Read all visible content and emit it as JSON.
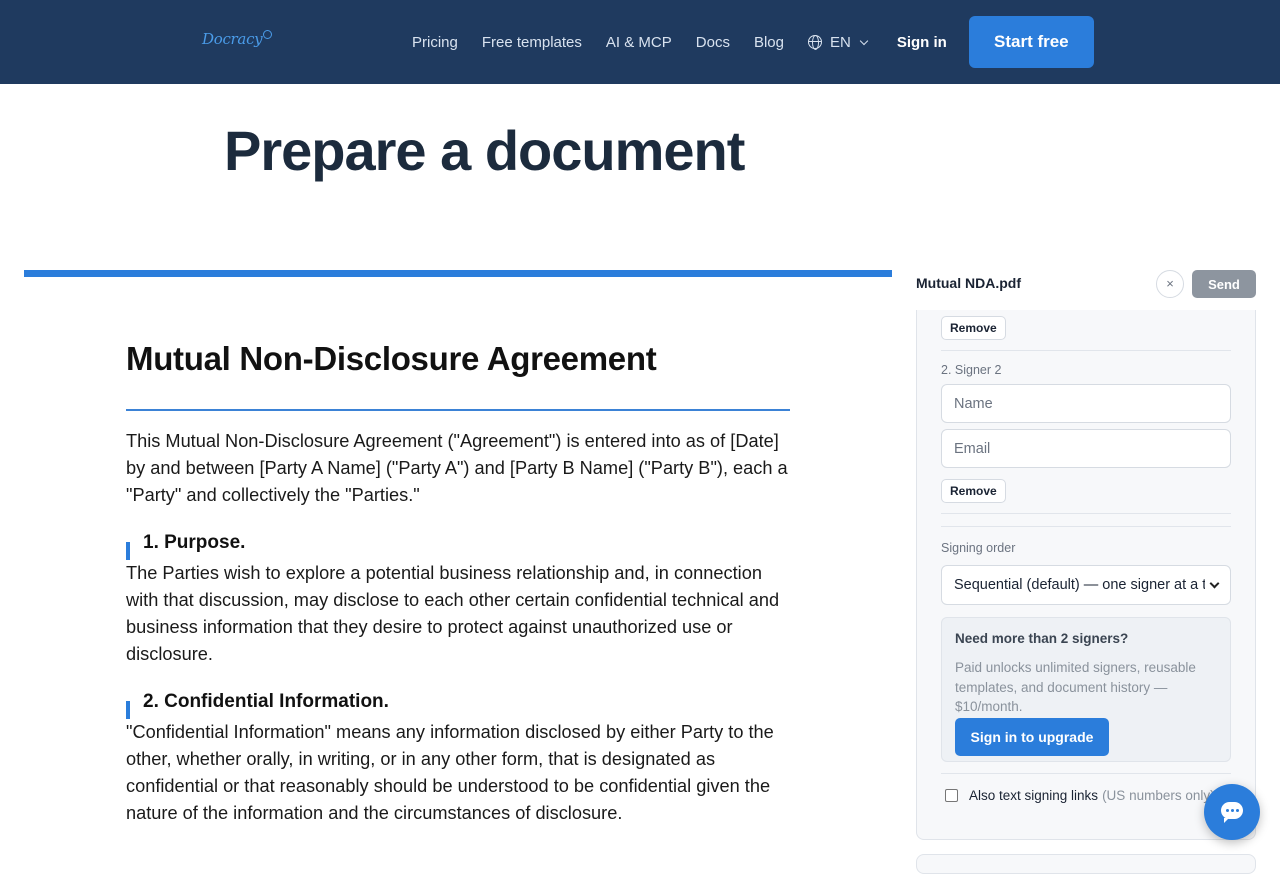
{
  "header": {
    "logo": "Docracy",
    "nav": [
      "Pricing",
      "Free templates",
      "AI & MCP",
      "Docs",
      "Blog"
    ],
    "language": "EN",
    "sign_in": "Sign in",
    "start_free": "Start free"
  },
  "page": {
    "title": "Prepare a document"
  },
  "document": {
    "title": "Mutual Non-Disclosure Agreement",
    "intro": "This Mutual Non-Disclosure Agreement (\"Agreement\") is entered into as of [Date] by and between [Party A Name] (\"Party A\") and [Party B Name] (\"Party B\"), each a \"Party\" and collectively the \"Parties.\"",
    "sections": [
      {
        "heading": "1. Purpose.",
        "body": "The Parties wish to explore a potential business relationship and, in connection with that discussion, may disclose to each other certain confidential technical and business information that they desire to protect against unauthorized use or disclosure."
      },
      {
        "heading": "2. Confidential Information.",
        "body": "\"Confidential Information\" means any information disclosed by either Party to the other, whether orally, in writing, or in any other form, that is designated as confidential or that reasonably should be understood to be confidential given the nature of the information and the circumstances of disclosure."
      }
    ]
  },
  "panel": {
    "file_name": "Mutual NDA.pdf",
    "close": "×",
    "send": "Send",
    "remove_1": "Remove",
    "signer_label": "2. Signer 2",
    "name_placeholder": "Name",
    "email_placeholder": "Email",
    "remove_2": "Remove",
    "signing_order_label": "Signing order",
    "signing_order_value": "Sequential (default) — one signer at a time",
    "upgrade": {
      "title": "Need more than 2 signers?",
      "text": "Paid unlocks unlimited signers, reusable templates, and document history — $10/month.",
      "button": "Sign in to upgrade"
    },
    "sms_label": "Also text signing links",
    "sms_hint": "(US numbers only)"
  },
  "colors": {
    "header_bg": "#1f3a5f",
    "accent": "#2b7ddb"
  }
}
